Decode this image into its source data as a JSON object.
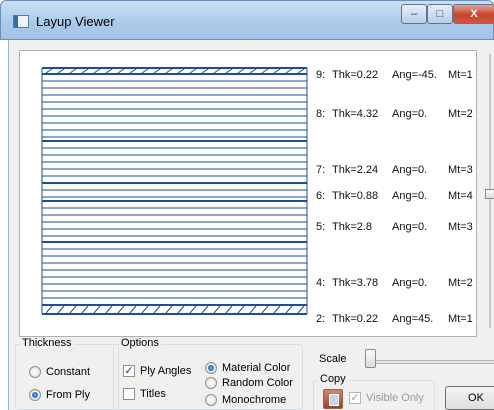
{
  "window": {
    "title": "Layup Viewer",
    "controls": [
      "–",
      "□",
      "X"
    ]
  },
  "layup": {
    "band_color": "#1f4f8f",
    "plies": [
      {
        "index": "9:",
        "thk": "Thk=0.22",
        "ang": "Ang=-45.",
        "mt": "Mt=1",
        "dashed": true
      },
      {
        "index": "8:",
        "thk": "Thk=4.32",
        "ang": "Ang=0.",
        "mt": "Mt=2",
        "dashed": false
      },
      {
        "index": "7:",
        "thk": "Thk=2.24",
        "ang": "Ang=0.",
        "mt": "Mt=3",
        "dashed": false
      },
      {
        "index": "6:",
        "thk": "Thk=0.88",
        "ang": "Ang=0.",
        "mt": "Mt=4",
        "dashed": false
      },
      {
        "index": "5:",
        "thk": "Thk=2.8",
        "ang": "Ang=0.",
        "mt": "Mt=3",
        "dashed": false
      },
      {
        "index": "4:",
        "thk": "Thk=3.78",
        "ang": "Ang=0.",
        "mt": "Mt=2",
        "dashed": false
      },
      {
        "index": "2:",
        "thk": "Thk=0.22",
        "ang": "Ang=45.",
        "mt": "Mt=1",
        "dashed": true
      }
    ]
  },
  "thickness": {
    "title": "Thickness",
    "constant_label": "Constant",
    "from_ply_label": "From Ply",
    "selected": "From Ply"
  },
  "options": {
    "title": "Options",
    "ply_angles_label": "Ply Angles",
    "ply_angles_checked": true,
    "titles_label": "Titles",
    "titles_checked": false,
    "material_color_label": "Material Color",
    "random_color_label": "Random Color",
    "monochrome_label": "Monochrome",
    "color_selected": "Material Color"
  },
  "scale": {
    "label": "Scale",
    "level": 0
  },
  "copy": {
    "label": "Copy",
    "visible_only_label": "Visible Only",
    "visible_only_checked": true
  },
  "ok_label": "OK"
}
